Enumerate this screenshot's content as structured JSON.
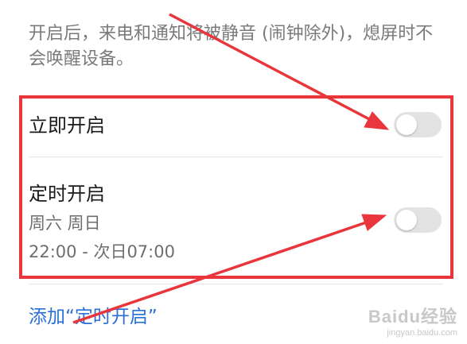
{
  "description": "开启后，来电和通知将被静音 (闹钟除外)，熄屏时不会唤醒设备。",
  "immediate": {
    "label": "立即开启",
    "enabled": false
  },
  "scheduled": {
    "label": "定时开启",
    "days": "周六 周日",
    "time_range": "22:00 - 次日07:00",
    "enabled": false
  },
  "add_link": "添加“定时开启”",
  "annotation_color": "#e8363c",
  "watermark": {
    "main": "Baidu经验",
    "sub": "jingyan.baidu.com"
  }
}
